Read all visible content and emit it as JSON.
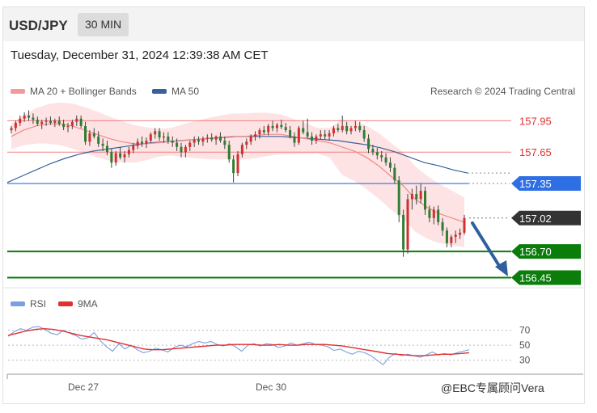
{
  "header": {
    "pair": "USD/JPY",
    "timeframe": "30 MIN"
  },
  "timestamp": "Tuesday, December 31, 2024 12:39:38 AM CET",
  "legend": {
    "bb": "MA 20 + Bollinger Bands",
    "ma50": "MA 50",
    "credit": "Research © 2024 Trading Central"
  },
  "rsi_legend": {
    "rsi": "RSI",
    "ma": "9MA"
  },
  "watermark": "@EBC专属顾问Vera",
  "colors": {
    "resistance": "#f08080",
    "support_blue": "#2f6fe4",
    "support_green": "#0a7d0a",
    "price": "#333333",
    "ma50": "#3a5f9a",
    "rsi": "#7b9fe0",
    "rsi_ma": "#e03030",
    "arrow": "#2f5f9e"
  },
  "chart_data": [
    {
      "type": "candlestick",
      "ylim": [
        156.4,
        158.1
      ],
      "x_ticks": [
        "Dec 27",
        "Dec 30"
      ],
      "levels": [
        {
          "label": "157.95",
          "value": 157.95,
          "style": "resistance"
        },
        {
          "label": "157.65",
          "value": 157.65,
          "style": "resistance"
        },
        {
          "label": "157.35",
          "value": 157.35,
          "style": "support_blue"
        },
        {
          "label": "157.02",
          "value": 157.02,
          "style": "price"
        },
        {
          "label": "156.70",
          "value": 156.7,
          "style": "support_green"
        },
        {
          "label": "156.45",
          "value": 156.45,
          "style": "support_green"
        }
      ],
      "candles": [
        [
          157.86,
          157.9,
          157.83,
          157.88
        ],
        [
          157.88,
          157.95,
          157.85,
          157.93
        ],
        [
          157.93,
          158.0,
          157.9,
          157.97
        ],
        [
          157.97,
          158.03,
          157.94,
          158.0
        ],
        [
          158.0,
          158.05,
          157.95,
          157.98
        ],
        [
          157.98,
          158.02,
          157.92,
          157.96
        ],
        [
          157.96,
          157.99,
          157.9,
          157.92
        ],
        [
          157.92,
          157.96,
          157.87,
          157.94
        ],
        [
          157.94,
          157.98,
          157.9,
          157.95
        ],
        [
          157.95,
          157.99,
          157.91,
          157.93
        ],
        [
          157.93,
          157.97,
          157.89,
          157.95
        ],
        [
          157.95,
          157.99,
          157.9,
          157.92
        ],
        [
          157.92,
          157.96,
          157.86,
          157.89
        ],
        [
          157.89,
          157.93,
          157.84,
          157.9
        ],
        [
          157.9,
          157.96,
          157.87,
          157.94
        ],
        [
          157.94,
          158.0,
          157.9,
          157.97
        ],
        [
          157.97,
          158.0,
          157.88,
          157.9
        ],
        [
          157.9,
          157.94,
          157.72,
          157.75
        ],
        [
          157.75,
          157.86,
          157.71,
          157.83
        ],
        [
          157.83,
          157.88,
          157.78,
          157.8
        ],
        [
          157.8,
          157.85,
          157.7,
          157.73
        ],
        [
          157.73,
          157.78,
          157.66,
          157.71
        ],
        [
          157.71,
          157.76,
          157.62,
          157.65
        ],
        [
          157.65,
          157.68,
          157.5,
          157.55
        ],
        [
          157.55,
          157.66,
          157.52,
          157.64
        ],
        [
          157.64,
          157.7,
          157.58,
          157.6
        ],
        [
          157.6,
          157.66,
          157.55,
          157.63
        ],
        [
          157.63,
          157.7,
          157.6,
          157.67
        ],
        [
          157.67,
          157.74,
          157.64,
          157.71
        ],
        [
          157.71,
          157.78,
          157.68,
          157.75
        ],
        [
          157.75,
          157.8,
          157.7,
          157.73
        ],
        [
          157.73,
          157.79,
          157.69,
          157.76
        ],
        [
          157.76,
          157.84,
          157.74,
          157.82
        ],
        [
          157.82,
          157.88,
          157.78,
          157.85
        ],
        [
          157.85,
          157.88,
          157.76,
          157.79
        ],
        [
          157.79,
          157.84,
          157.74,
          157.8
        ],
        [
          157.8,
          157.84,
          157.73,
          157.76
        ],
        [
          157.76,
          157.8,
          157.7,
          157.74
        ],
        [
          157.74,
          157.78,
          157.66,
          157.7
        ],
        [
          157.7,
          157.74,
          157.6,
          157.65
        ],
        [
          157.65,
          157.72,
          157.6,
          157.7
        ],
        [
          157.7,
          157.76,
          157.66,
          157.74
        ],
        [
          157.74,
          157.8,
          157.7,
          157.77
        ],
        [
          157.77,
          157.8,
          157.72,
          157.75
        ],
        [
          157.75,
          157.8,
          157.71,
          157.78
        ],
        [
          157.78,
          157.82,
          157.74,
          157.79
        ],
        [
          157.79,
          157.83,
          157.75,
          157.77
        ],
        [
          157.77,
          157.81,
          157.72,
          157.8
        ],
        [
          157.8,
          157.84,
          157.74,
          157.76
        ],
        [
          157.76,
          157.8,
          157.68,
          157.72
        ],
        [
          157.72,
          157.76,
          157.55,
          157.58
        ],
        [
          157.58,
          157.62,
          157.36,
          157.45
        ],
        [
          157.45,
          157.66,
          157.42,
          157.63
        ],
        [
          157.63,
          157.74,
          157.6,
          157.72
        ],
        [
          157.72,
          157.78,
          157.68,
          157.75
        ],
        [
          157.75,
          157.82,
          157.72,
          157.8
        ],
        [
          157.8,
          157.85,
          157.76,
          157.82
        ],
        [
          157.82,
          157.88,
          157.78,
          157.86
        ],
        [
          157.86,
          157.9,
          157.82,
          157.84
        ],
        [
          157.84,
          157.92,
          157.81,
          157.9
        ],
        [
          157.9,
          157.95,
          157.85,
          157.88
        ],
        [
          157.88,
          157.93,
          157.84,
          157.91
        ],
        [
          157.91,
          157.96,
          157.87,
          157.89
        ],
        [
          157.89,
          157.93,
          157.84,
          157.86
        ],
        [
          157.86,
          157.9,
          157.78,
          157.8
        ],
        [
          157.8,
          157.84,
          157.7,
          157.74
        ],
        [
          157.74,
          157.9,
          157.72,
          157.88
        ],
        [
          157.88,
          157.95,
          157.82,
          157.84
        ],
        [
          157.84,
          157.97,
          157.78,
          157.8
        ],
        [
          157.8,
          157.84,
          157.72,
          157.76
        ],
        [
          157.76,
          157.82,
          157.73,
          157.8
        ],
        [
          157.8,
          157.86,
          157.77,
          157.82
        ],
        [
          157.82,
          157.86,
          157.77,
          157.8
        ],
        [
          157.8,
          157.86,
          157.76,
          157.83
        ],
        [
          157.83,
          157.9,
          157.8,
          157.88
        ],
        [
          157.88,
          157.92,
          157.84,
          157.86
        ],
        [
          157.86,
          158.0,
          157.84,
          157.9
        ],
        [
          157.9,
          157.94,
          157.82,
          157.85
        ],
        [
          157.85,
          157.9,
          157.82,
          157.88
        ],
        [
          157.88,
          157.95,
          157.85,
          157.9
        ],
        [
          157.9,
          157.94,
          157.84,
          157.86
        ],
        [
          157.86,
          157.9,
          157.75,
          157.78
        ],
        [
          157.78,
          157.82,
          157.64,
          157.68
        ],
        [
          157.68,
          157.72,
          157.62,
          157.65
        ],
        [
          157.65,
          157.69,
          157.58,
          157.62
        ],
        [
          157.62,
          157.66,
          157.56,
          157.6
        ],
        [
          157.6,
          157.64,
          157.52,
          157.55
        ],
        [
          157.55,
          157.6,
          157.46,
          157.5
        ],
        [
          157.5,
          157.54,
          157.35,
          157.38
        ],
        [
          157.38,
          157.42,
          156.98,
          157.05
        ],
        [
          157.05,
          157.1,
          156.65,
          156.72
        ],
        [
          156.72,
          157.25,
          156.68,
          157.2
        ],
        [
          157.2,
          157.3,
          157.1,
          157.25
        ],
        [
          157.25,
          157.33,
          157.15,
          157.2
        ],
        [
          157.2,
          157.35,
          157.16,
          157.28
        ],
        [
          157.28,
          157.32,
          157.05,
          157.1
        ],
        [
          157.1,
          157.14,
          156.98,
          157.02
        ],
        [
          157.02,
          157.13,
          156.96,
          157.1
        ],
        [
          157.1,
          157.14,
          156.95,
          156.98
        ],
        [
          156.98,
          157.02,
          156.85,
          156.9
        ],
        [
          156.9,
          156.93,
          156.74,
          156.78
        ],
        [
          156.78,
          156.86,
          156.74,
          156.84
        ],
        [
          156.84,
          156.9,
          156.78,
          156.86
        ],
        [
          156.86,
          156.92,
          156.82,
          156.88
        ],
        [
          156.88,
          157.05,
          156.86,
          157.02
        ]
      ],
      "ma20": [
        157.8,
        157.86,
        157.9,
        157.92,
        157.92,
        157.9,
        157.86,
        157.82,
        157.78,
        157.75,
        157.73,
        157.73,
        157.74,
        157.75,
        157.76,
        157.77,
        157.78,
        157.79,
        157.8,
        157.8,
        157.81,
        157.82,
        157.82,
        157.8,
        157.78,
        157.76,
        157.74,
        157.7,
        157.66,
        157.6,
        157.52,
        157.42,
        157.33,
        157.2,
        157.12,
        157.06,
        157.02,
        156.98
      ],
      "ma50": [
        157.36,
        157.42,
        157.48,
        157.54,
        157.59,
        157.63,
        157.66,
        157.68,
        157.7,
        157.72,
        157.74,
        157.75,
        157.76,
        157.77,
        157.78,
        157.79,
        157.8,
        157.8,
        157.8,
        157.8,
        157.79,
        157.78,
        157.77,
        157.76,
        157.74,
        157.72,
        157.69,
        157.65,
        157.6,
        157.55,
        157.52,
        157.48,
        157.45
      ]
    },
    {
      "type": "line",
      "ylim": [
        20,
        90
      ],
      "y_ticks": [
        "70",
        "50",
        "30"
      ],
      "series": [
        {
          "name": "RSI",
          "values": [
            62,
            68,
            72,
            70,
            74,
            75,
            71,
            66,
            64,
            70,
            66,
            63,
            58,
            60,
            67,
            56,
            48,
            42,
            52,
            45,
            50,
            44,
            40,
            42,
            46,
            44,
            41,
            47,
            50,
            48,
            52,
            55,
            53,
            55,
            51,
            49,
            52,
            48,
            42,
            50,
            52,
            49,
            52,
            51,
            47,
            49,
            53,
            50,
            52,
            54,
            51,
            50,
            48,
            43,
            45,
            41,
            38,
            42,
            40,
            36,
            30,
            24,
            34,
            39,
            36,
            38,
            36,
            34,
            37,
            41,
            37,
            39,
            37,
            40,
            42,
            44
          ]
        },
        {
          "name": "9MA",
          "values": [
            63,
            66,
            69,
            71,
            72,
            71,
            69,
            66,
            63,
            61,
            59,
            57,
            54,
            51,
            48,
            45,
            44,
            44,
            45,
            46,
            47,
            48,
            49,
            50,
            50,
            51,
            51,
            51,
            50,
            50,
            51,
            50,
            50,
            51,
            51,
            51,
            50,
            49,
            47,
            45,
            43,
            41,
            39,
            38,
            37,
            36,
            36,
            37,
            38,
            38,
            39,
            40
          ]
        }
      ]
    }
  ]
}
